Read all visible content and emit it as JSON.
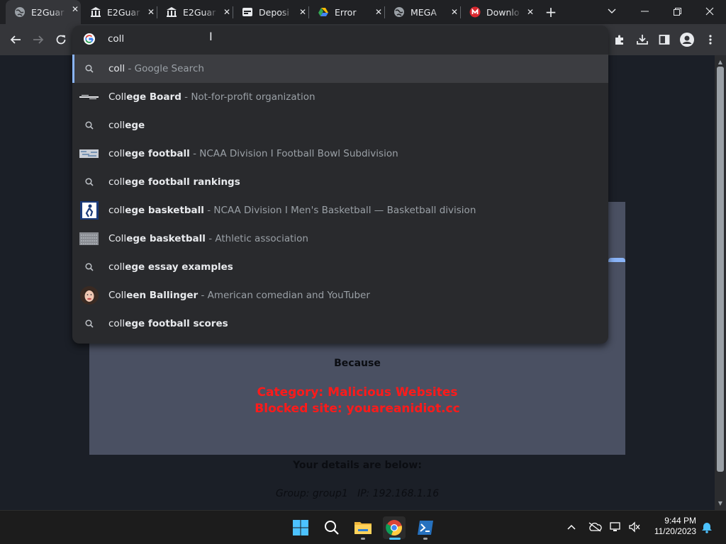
{
  "tabs": [
    {
      "title": "E2Guar",
      "icon": "globe-icon",
      "active": true
    },
    {
      "title": "E2Guar",
      "icon": "bank-icon"
    },
    {
      "title": "E2Guar",
      "icon": "bank-icon"
    },
    {
      "title": "Deposi",
      "icon": "depositfiles-icon"
    },
    {
      "title": "Error",
      "icon": "google-drive-icon"
    },
    {
      "title": "MEGA",
      "icon": "globe-icon"
    },
    {
      "title": "Downlo",
      "icon": "mega-icon"
    }
  ],
  "omnibox": {
    "input_value": "coll",
    "suggestions": [
      {
        "match": "coll",
        "rest": "",
        "desc": " - Google Search",
        "icon": "search-icon",
        "selected": true,
        "bold": false
      },
      {
        "match": "Coll",
        "rest": "ege Board",
        "desc": " - Not-for-profit organization",
        "icon": "college-board-logo",
        "bold": true
      },
      {
        "match": "coll",
        "rest": "ege",
        "desc": "",
        "icon": "search-icon",
        "bold": true
      },
      {
        "match": "coll",
        "rest": "ege football",
        "desc": " - NCAA Division I Football Bowl Subdivision",
        "icon": "football-thumbnail",
        "bold": true
      },
      {
        "match": "coll",
        "rest": "ege football rankings",
        "desc": "",
        "icon": "search-icon",
        "bold": true
      },
      {
        "match": "coll",
        "rest": "ege basketball",
        "desc": " - NCAA Division I Men's Basketball — Basketball division",
        "icon": "basketball-thumbnail",
        "bold": true
      },
      {
        "match": "Coll",
        "rest": "ege basketball",
        "desc": " - Athletic association",
        "icon": "association-thumbnail",
        "bold": true
      },
      {
        "match": "coll",
        "rest": "ege essay examples",
        "desc": "",
        "icon": "search-icon",
        "bold": true
      },
      {
        "match": "Coll",
        "rest": "een Ballinger",
        "desc": " - American comedian and YouTuber",
        "icon": "person-avatar",
        "bold": true
      },
      {
        "match": "coll",
        "rest": "ege football scores",
        "desc": "",
        "icon": "search-icon",
        "bold": true
      }
    ]
  },
  "page": {
    "because": "Because",
    "category": "Category: Malicious Websites",
    "blocked": "Blocked site: youareanidiot.cc",
    "details_heading": "Your details are below:",
    "group_line": "Group: group1   IP: 192.168.1.16"
  },
  "clock": {
    "time": "9:44 PM",
    "date": "11/20/2023"
  },
  "colors": {
    "accent": "#8ab4f8",
    "blocked_red": "#ff1a1a",
    "card": "#4a5062"
  }
}
